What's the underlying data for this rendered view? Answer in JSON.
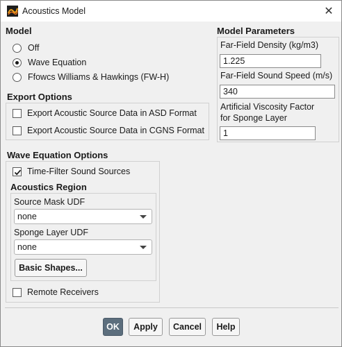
{
  "window": {
    "title": "Acoustics Model",
    "close_glyph": "✕"
  },
  "model": {
    "heading": "Model",
    "options": [
      {
        "label": "Off",
        "selected": false
      },
      {
        "label": "Wave Equation",
        "selected": true
      },
      {
        "label": "Ffowcs Williams & Hawkings (FW-H)",
        "selected": false
      }
    ]
  },
  "export": {
    "heading": "Export Options",
    "options": [
      {
        "label": "Export Acoustic Source Data in ASD Format",
        "checked": false
      },
      {
        "label": "Export Acoustic Source Data in CGNS Format",
        "checked": false
      }
    ]
  },
  "params": {
    "heading": "Model Parameters",
    "density_label": "Far-Field Density (kg/m3)",
    "density_value": "1.225",
    "speed_label": "Far-Field Sound Speed (m/s)",
    "speed_value": "340",
    "viscosity_label_1": "Artificial Viscosity Factor",
    "viscosity_label_2": "for Sponge Layer",
    "viscosity_value": "1"
  },
  "wave": {
    "heading": "Wave Equation Options",
    "time_filter_label": "Time-Filter Sound Sources",
    "time_filter_checked": true,
    "region_heading": "Acoustics Region",
    "source_mask_label": "Source Mask UDF",
    "source_mask_value": "none",
    "sponge_label": "Sponge Layer UDF",
    "sponge_value": "none",
    "basic_shapes_label": "Basic Shapes...",
    "remote_label": "Remote Receivers",
    "remote_checked": false
  },
  "footer": {
    "ok": "OK",
    "apply": "Apply",
    "cancel": "Cancel",
    "help": "Help"
  },
  "colors": {
    "primary_button": "#5c6e7d",
    "background": "#f0f0f0"
  }
}
